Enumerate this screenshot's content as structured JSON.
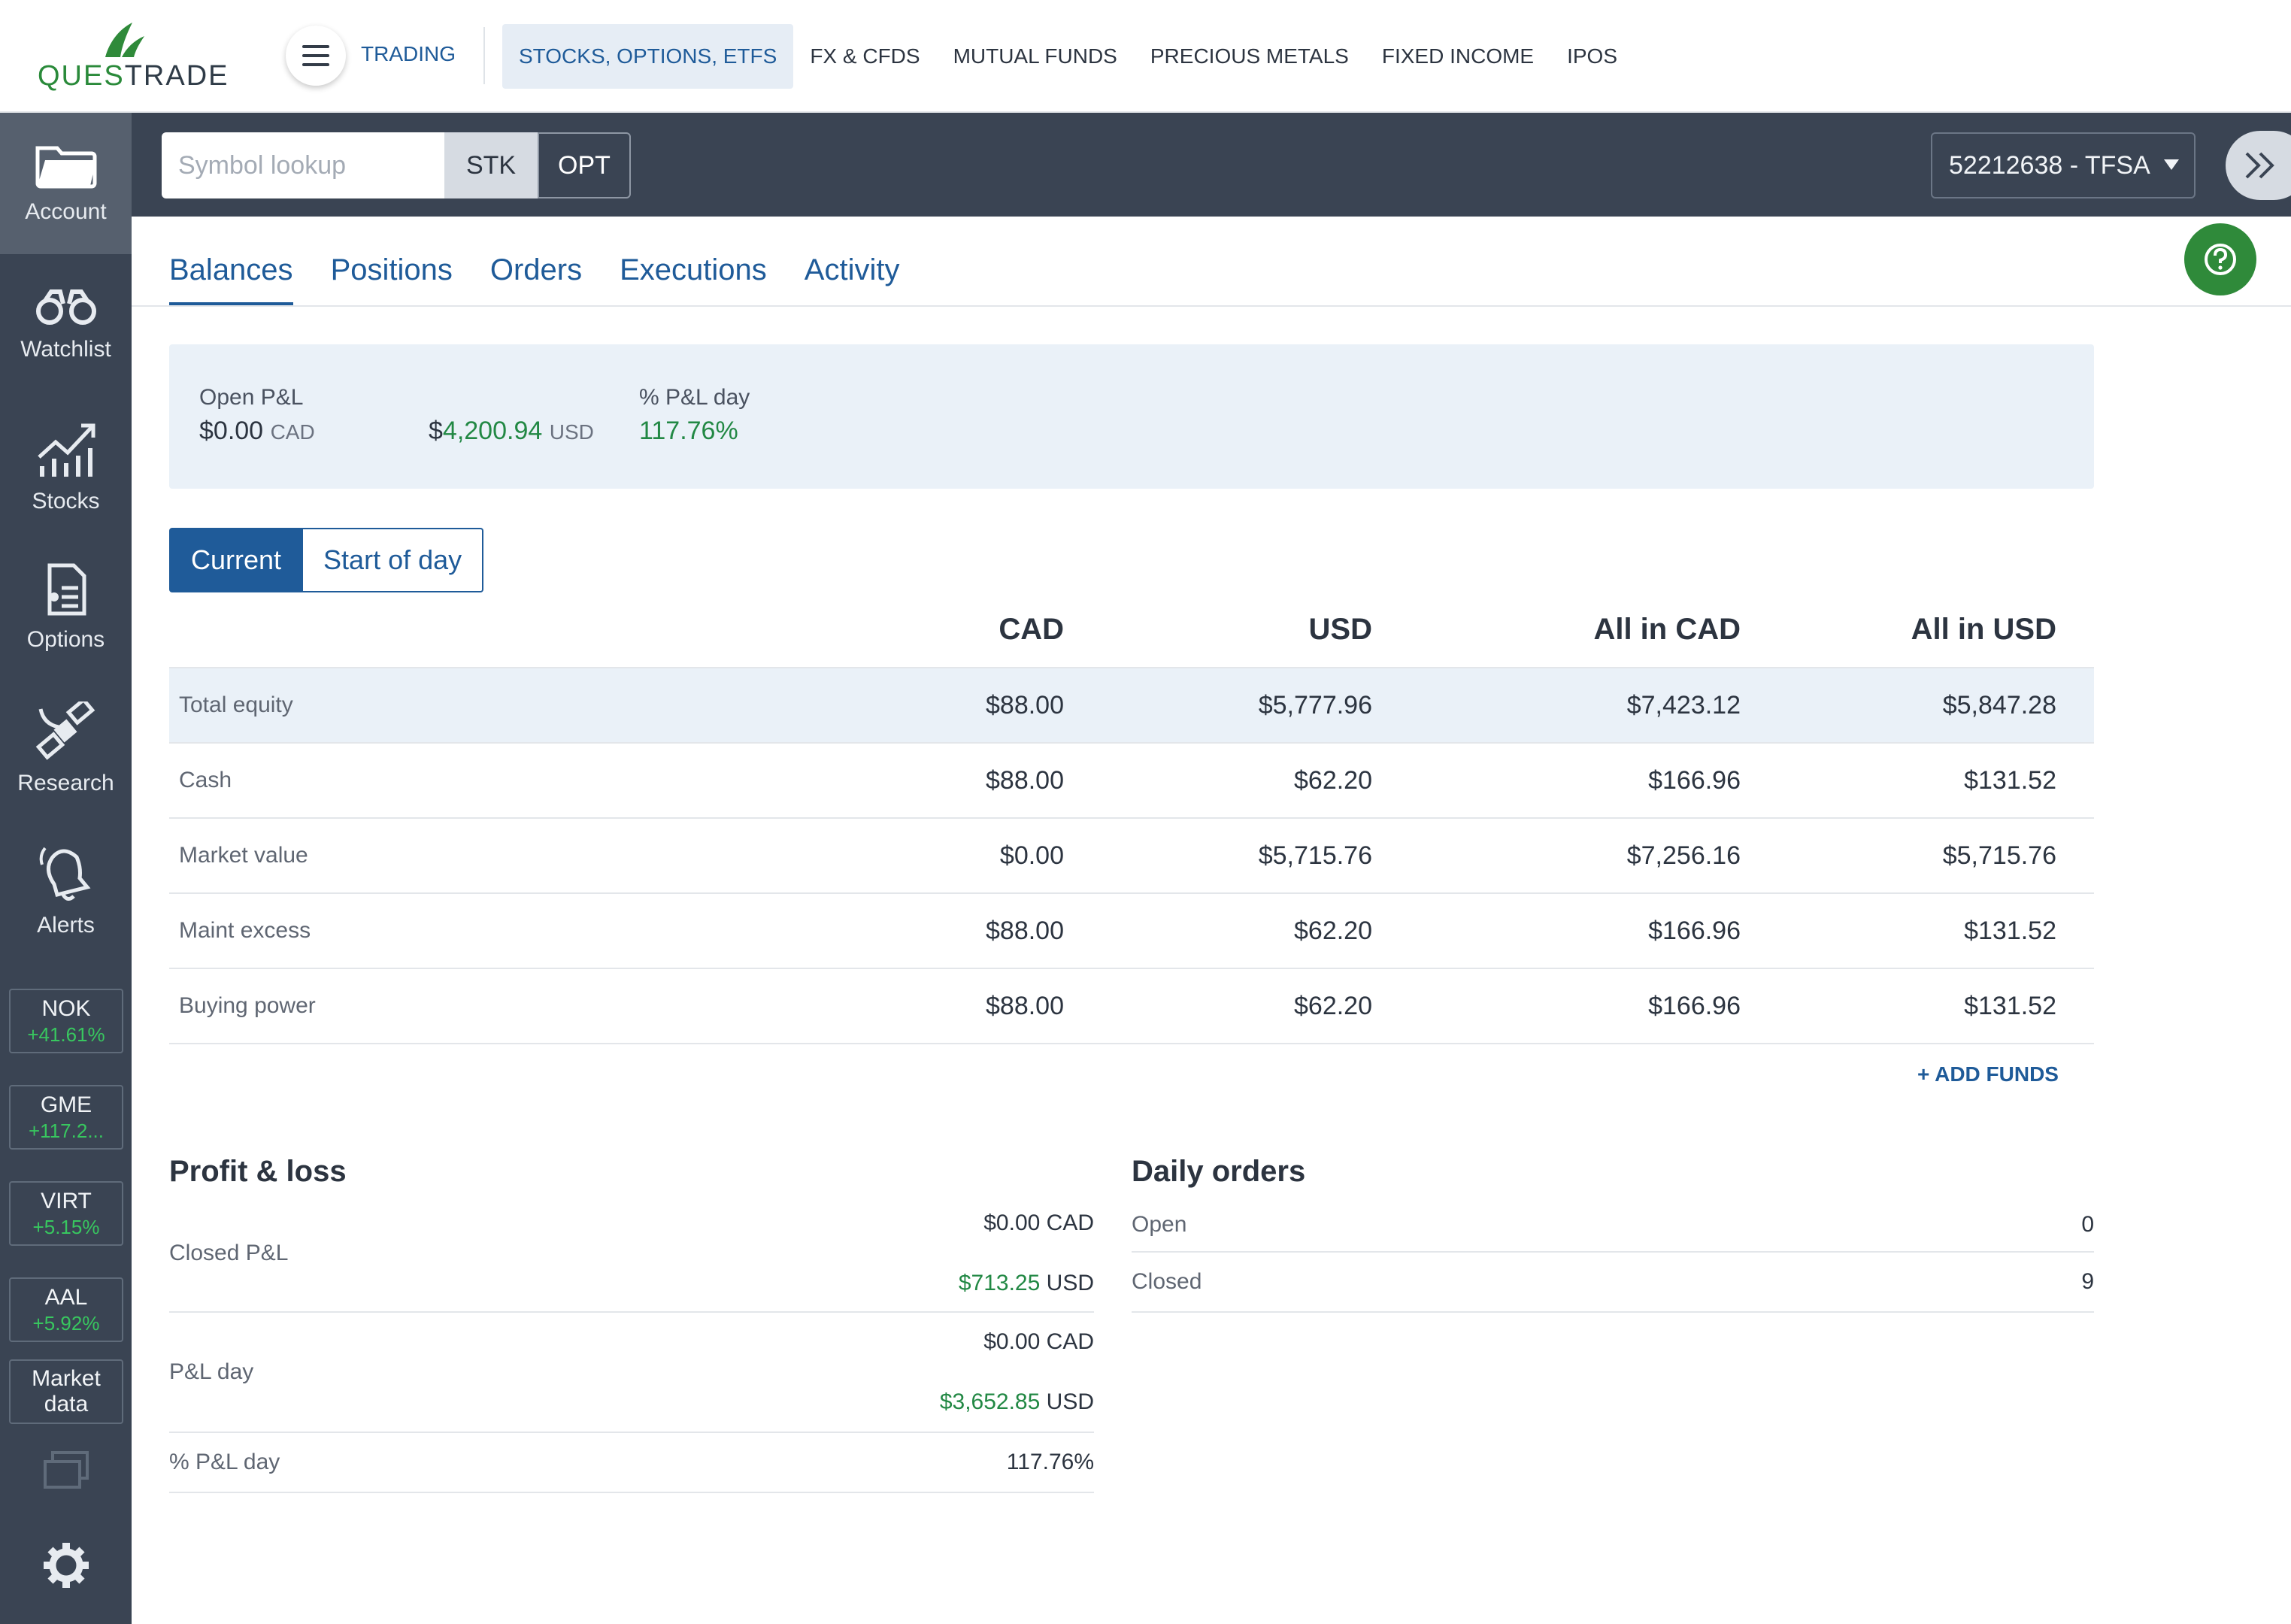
{
  "brand": {
    "logo_prefix": "QUES",
    "logo_suffix": "TRADE",
    "accent": "#2f8a3a"
  },
  "topnav": {
    "trading_label": "TRADING",
    "items": [
      "STOCKS, OPTIONS, ETFS",
      "FX & CFDS",
      "MUTUAL FUNDS",
      "PRECIOUS METALS",
      "FIXED INCOME",
      "IPOS"
    ],
    "active_item": "STOCKS, OPTIONS, ETFS"
  },
  "sidebar": {
    "items": [
      {
        "label": "Account",
        "icon": "folder-icon",
        "active": true
      },
      {
        "label": "Watchlist",
        "icon": "binoculars-icon"
      },
      {
        "label": "Stocks",
        "icon": "chart-up-icon"
      },
      {
        "label": "Options",
        "icon": "document-list-icon"
      },
      {
        "label": "Research",
        "icon": "satellite-icon"
      },
      {
        "label": "Alerts",
        "icon": "bell-icon"
      }
    ],
    "tickers": [
      {
        "symbol": "NOK",
        "change": "+41.61%"
      },
      {
        "symbol": "GME",
        "change": "+117.2..."
      },
      {
        "symbol": "VIRT",
        "change": "+5.15%"
      },
      {
        "symbol": "AAL",
        "change": "+5.92%"
      }
    ],
    "market_data_label": "Market data",
    "bottom_icons": [
      "windows-icon",
      "gear-icon"
    ]
  },
  "toolbar": {
    "symbol_placeholder": "Symbol lookup",
    "stk_label": "STK",
    "opt_label": "OPT",
    "account_label": "52212638 - TFSA"
  },
  "tabs": [
    "Balances",
    "Positions",
    "Orders",
    "Executions",
    "Activity"
  ],
  "active_tab": "Balances",
  "summary": {
    "open_pnl_label": "Open P&L",
    "open_pnl_cad_value": "0.00",
    "open_pnl_cad_currency": "CAD",
    "open_pnl_usd_value": "4,200.94",
    "open_pnl_usd_currency": "USD",
    "dollar_sign": "$",
    "pct_pnl_day_label": "% P&L day",
    "pct_pnl_day_value": "117.76%"
  },
  "toggle": {
    "current": "Current",
    "start_of_day": "Start of day"
  },
  "balances": {
    "columns": [
      "CAD",
      "USD",
      "All in CAD",
      "All in USD"
    ],
    "rows": [
      {
        "label": "Total equity",
        "values": [
          "$88.00",
          "$5,777.96",
          "$7,423.12",
          "$5,847.28"
        ]
      },
      {
        "label": "Cash",
        "values": [
          "$88.00",
          "$62.20",
          "$166.96",
          "$131.52"
        ]
      },
      {
        "label": "Market value",
        "values": [
          "$0.00",
          "$5,715.76",
          "$7,256.16",
          "$5,715.76"
        ]
      },
      {
        "label": "Maint excess",
        "values": [
          "$88.00",
          "$62.20",
          "$166.96",
          "$131.52"
        ]
      },
      {
        "label": "Buying power",
        "values": [
          "$88.00",
          "$62.20",
          "$166.96",
          "$131.52"
        ]
      }
    ],
    "add_funds_label": "+ ADD FUNDS"
  },
  "profit_loss": {
    "title": "Profit & loss",
    "closed_label": "Closed P&L",
    "closed_cad": "$0.00 CAD",
    "closed_usd_value": "$713.25",
    "closed_usd_currency": "USD",
    "pnl_day_label": "P&L day",
    "pnl_day_cad": "$0.00 CAD",
    "pnl_day_usd_value": "$3,652.85",
    "pnl_day_usd_currency": "USD",
    "pct_label": "% P&L day",
    "pct_value": "117.76%"
  },
  "daily_orders": {
    "title": "Daily orders",
    "open_label": "Open",
    "open_value": "0",
    "closed_label": "Closed",
    "closed_value": "9"
  }
}
